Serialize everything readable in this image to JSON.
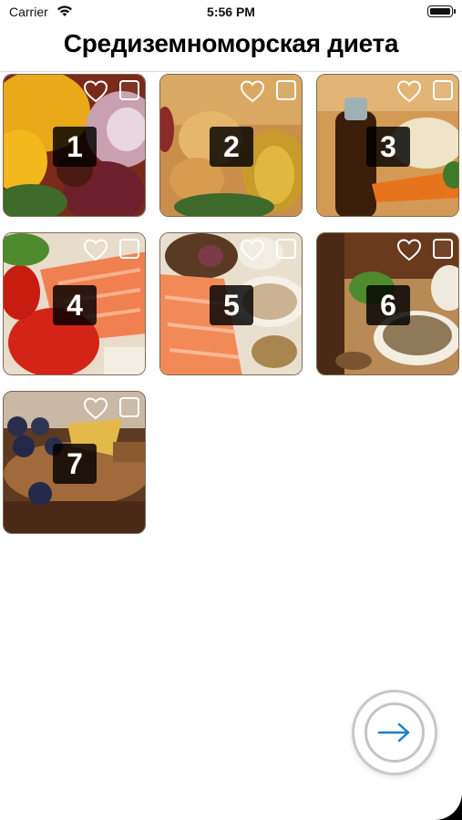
{
  "status": {
    "carrier": "Carrier",
    "time": "5:56 PM"
  },
  "header": {
    "title": "Средиземноморская диета"
  },
  "tiles": [
    {
      "number": "1",
      "photo": "vegetables-onion-pepper"
    },
    {
      "number": "2",
      "photo": "onion-olive-oil"
    },
    {
      "number": "3",
      "photo": "oil-bottle-carrots"
    },
    {
      "number": "4",
      "photo": "salmon-tomato"
    },
    {
      "number": "5",
      "photo": "salmon-grains-nuts"
    },
    {
      "number": "6",
      "photo": "lentils-herbs"
    },
    {
      "number": "7",
      "photo": "blueberries-cheese"
    }
  ],
  "next_button": {
    "icon": "arrow-right-icon",
    "accent": "#1e7fc4"
  }
}
